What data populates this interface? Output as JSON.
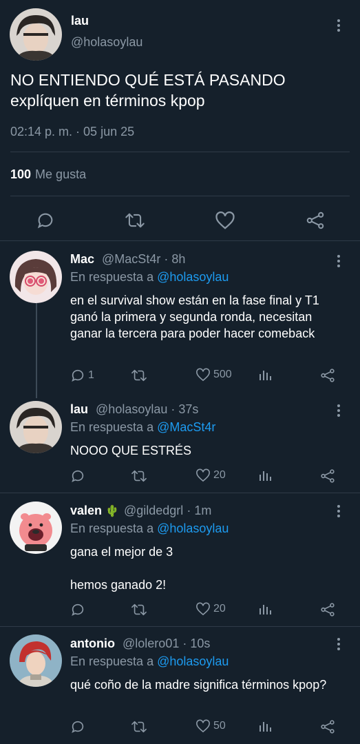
{
  "main_tweet": {
    "name": "lau",
    "handle": "@holasoylau",
    "text": "NO ENTIENDO QUÉ ESTÁ PASANDO explíquen en términos kpop",
    "timestamp": "02:14 p. m. · 05 jun 25",
    "likes_count": "100",
    "likes_label": "Me gusta"
  },
  "replies": [
    {
      "name": "Mac",
      "handle": "@MacSt4r",
      "time": "· 8h",
      "reply_prefix": "En respuesta a",
      "reply_to": "@holasoylau",
      "text": "en el survival show están en la fase final y T1 ganó la primera y segunda ronda, necesitan ganar la tercera para poder hacer comeback",
      "reply_count": "1",
      "retweet_count": "",
      "like_count": "500"
    },
    {
      "name": "lau",
      "handle": "@holasoylau",
      "time": "· 37s",
      "reply_prefix": "En respuesta a",
      "reply_to": "@MacSt4r",
      "text": "NOOO QUE ESTRÉS",
      "reply_count": "",
      "retweet_count": "",
      "like_count": "20"
    },
    {
      "name": "valen",
      "badge": "🌵",
      "handle": "@gildedgrl",
      "time": "· 1m",
      "reply_prefix": "En respuesta a",
      "reply_to": "@holasoylau",
      "text": "gana el mejor de 3\n\nhemos ganado 2!",
      "reply_count": "",
      "retweet_count": "",
      "like_count": "20"
    },
    {
      "name": "antonio",
      "handle": "@lolero01",
      "time": "· 10s",
      "reply_prefix": "En respuesta a",
      "reply_to": "@holasoylau",
      "text": "qué coño de la madre significa términos kpop?",
      "reply_count": "",
      "retweet_count": "",
      "like_count": "50"
    }
  ],
  "icons": {
    "reply": "reply-bubble-icon",
    "retweet": "retweet-icon",
    "like": "heart-icon",
    "share": "share-icon",
    "stats": "analytics-icon",
    "more": "more-vertical-icon"
  },
  "colors": {
    "background": "#15202b",
    "accent": "#1d9bf0",
    "muted": "#8b98a5",
    "divider": "#2f3b48"
  }
}
